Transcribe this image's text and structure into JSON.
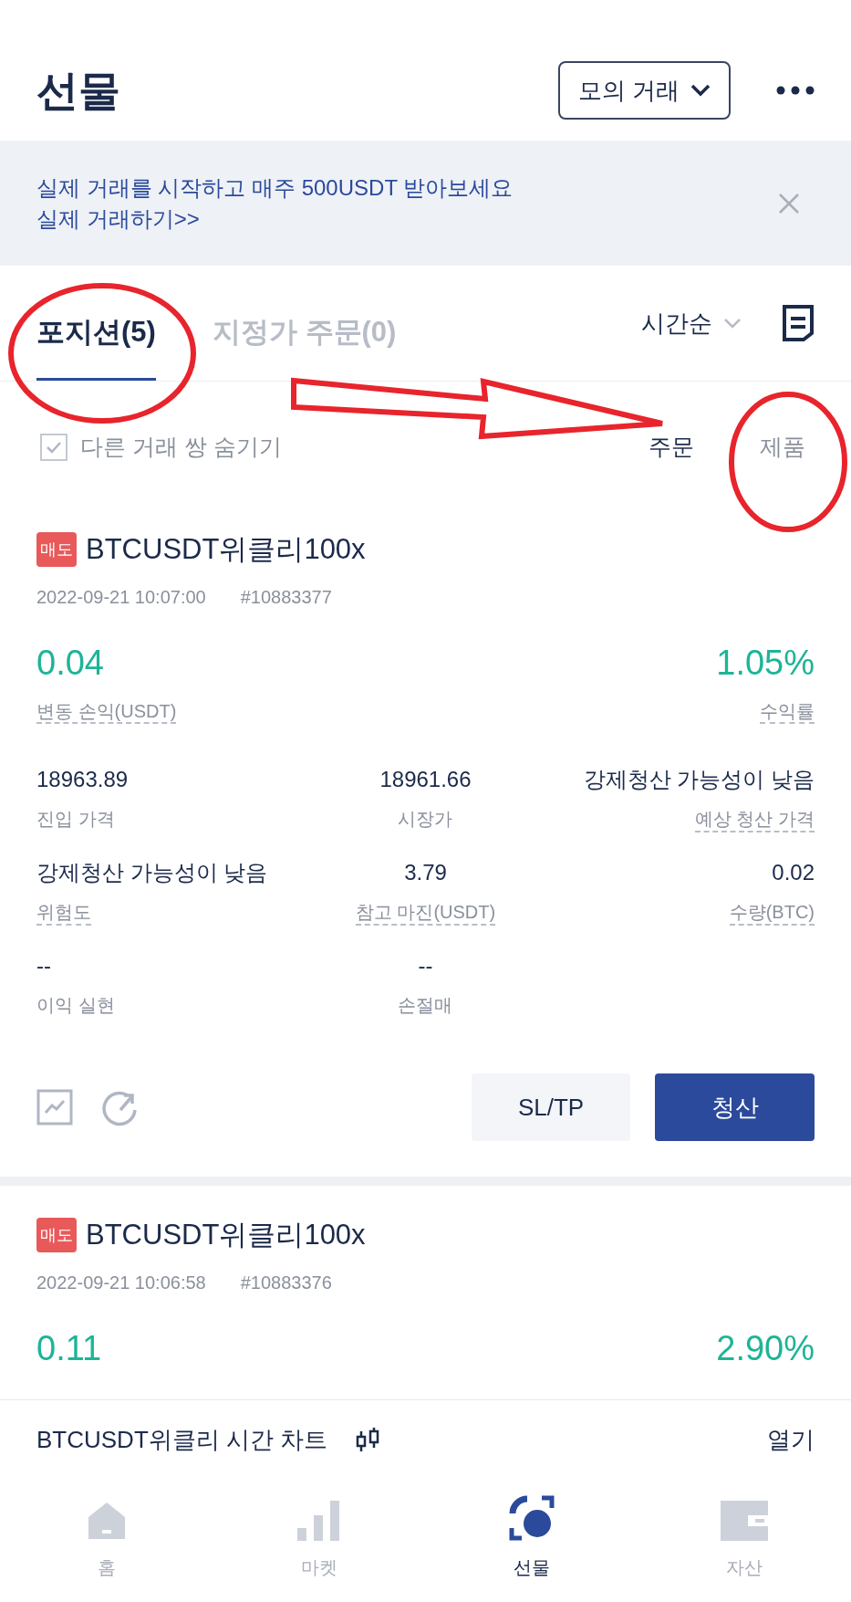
{
  "header": {
    "title": "선물",
    "mode": "모의 거래"
  },
  "banner": {
    "text": "실제 거래를 시작하고 매주 500USDT 받아보세요",
    "link": "실제 거래하기>>"
  },
  "tabs": [
    {
      "label": "포지션(5)",
      "selected": true
    },
    {
      "label": "지정가 주문(0)",
      "selected": false
    }
  ],
  "sort": "시간순",
  "filter": {
    "label": "다른 거래 쌍 숨기기",
    "checked": true
  },
  "view_toggle": [
    {
      "label": "주문",
      "selected": true
    },
    {
      "label": "제품",
      "selected": false
    }
  ],
  "positions": [
    {
      "side": "매도",
      "symbol": "BTCUSDT위클리100x",
      "time": "2022-09-21 10:07:00",
      "id": "#10883377",
      "pnl": "0.04",
      "pnl_label": "변동 손익(USDT)",
      "roe": "1.05%",
      "roe_label": "수익률",
      "fields": [
        {
          "value": "18963.89",
          "label": "진입 가격",
          "dotted": false
        },
        {
          "value": "18961.66",
          "label": "시장가",
          "dotted": false
        },
        {
          "value": "강제청산 가능성이 낮음",
          "label": "예상 청산 가격",
          "dotted": true
        },
        {
          "value": "강제청산 가능성이 낮음",
          "label": "위험도",
          "dotted": true
        },
        {
          "value": "3.79",
          "label": "참고 마진(USDT)",
          "dotted": true
        },
        {
          "value": "0.02",
          "label": "수량(BTC)",
          "dotted": true
        },
        {
          "value": "--",
          "label": "이익 실현",
          "dotted": false
        },
        {
          "value": "--",
          "label": "손절매",
          "dotted": false
        }
      ],
      "buttons": [
        "SL/TP",
        "청산"
      ]
    },
    {
      "side": "매도",
      "symbol": "BTCUSDT위클리100x",
      "time": "2022-09-21 10:06:58",
      "id": "#10883376",
      "pnl": "0.11",
      "roe": "2.90%"
    }
  ],
  "chart_bar": {
    "title": "BTCUSDT위클리 시간 차트",
    "action": "열기"
  },
  "nav": [
    {
      "label": "홈",
      "selected": false
    },
    {
      "label": "마켓",
      "selected": false
    },
    {
      "label": "선물",
      "selected": true
    },
    {
      "label": "자산",
      "selected": false
    }
  ]
}
